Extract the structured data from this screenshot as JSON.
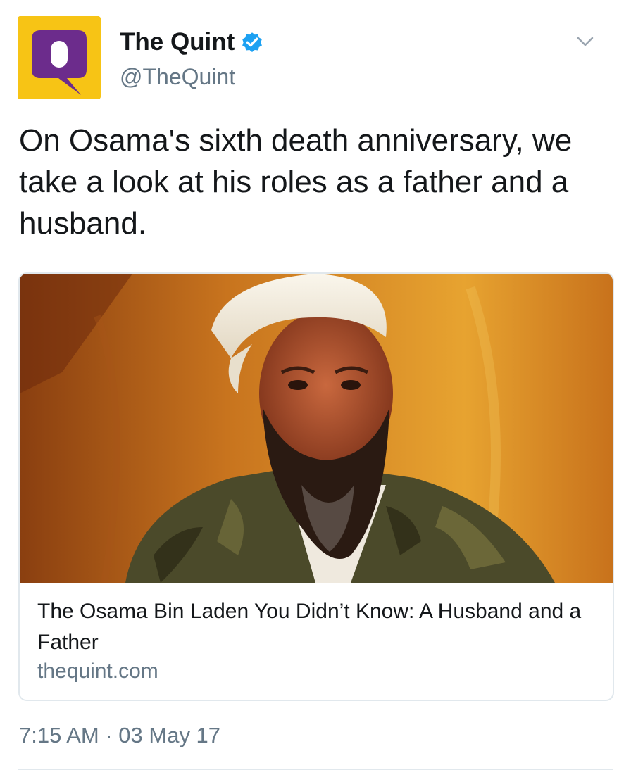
{
  "account": {
    "display_name": "The Quint",
    "handle": "@TheQuint",
    "verified": true,
    "avatar_icon": "quint-q-logo-icon",
    "avatar_bg": "#f7c415",
    "avatar_fg": "#6c2c8c"
  },
  "tweet": {
    "text": "On Osama's sixth death anniversary, we take a look at his roles as a father and a husband."
  },
  "card": {
    "image": "photo-man-white-turban-camouflage-jacket",
    "title": "The Osama Bin Laden You Didn’t Know: A Husband and a Father",
    "domain": "thequint.com"
  },
  "meta": {
    "timestamp": "7:15 AM · 03 May 17"
  },
  "colors": {
    "verified": "#1da1f2",
    "secondary_text": "#657786",
    "border": "#e1e8ed"
  }
}
